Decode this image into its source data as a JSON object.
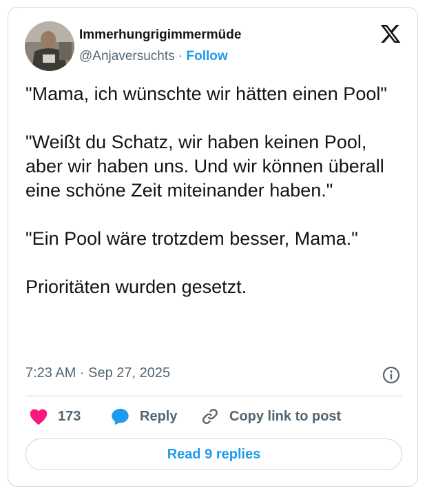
{
  "author": {
    "display_name": "Immerhungrigimmermüde",
    "handle": "@Anjaversuchts",
    "separator": "·",
    "follow_label": "Follow"
  },
  "tweet": {
    "paragraphs": [
      "\"Mama, ich wünschte wir hätten einen Pool\"",
      "\"Weißt du Schatz, wir haben keinen Pool, aber wir haben uns. Und wir können überall eine schöne Zeit miteinander haben.\"",
      "\"Ein Pool wäre trotzdem besser, Mama.\"",
      "Prioritäten wurden gesetzt."
    ],
    "timestamp": "7:23 AM · Sep 27, 2025"
  },
  "actions": {
    "like_count": "173",
    "reply_label": "Reply",
    "copy_link_label": "Copy link to post"
  },
  "read_replies_label": "Read 9 replies",
  "colors": {
    "accent": "#1d9bf0",
    "like": "#f91880",
    "secondary_text": "#536471",
    "border": "#cfd9de"
  },
  "icons": [
    "x-logo-icon",
    "info-icon",
    "heart-icon",
    "reply-bubble-icon",
    "link-icon"
  ]
}
